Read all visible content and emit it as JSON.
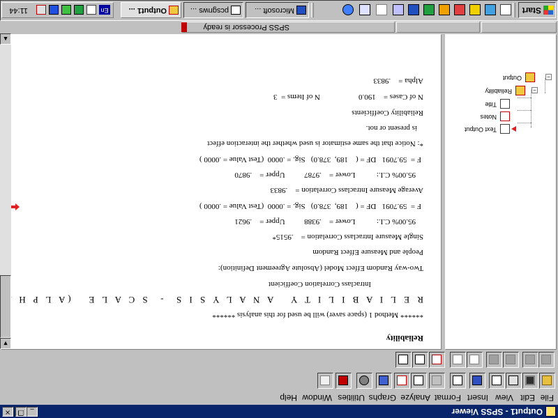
{
  "window": {
    "title": "Output1 - SPSS Viewer",
    "min_label": "_",
    "max_label": "❐",
    "close_label": "×"
  },
  "menu": [
    "File",
    "Edit",
    "View",
    "Insert",
    "Format",
    "Analyze",
    "Graphs",
    "Utilities",
    "Window",
    "Help"
  ],
  "outline": {
    "items": [
      {
        "label": "Output",
        "icon": "output-book-icon"
      },
      {
        "label": "Reliability",
        "icon": "procedure-book-icon"
      },
      {
        "label": "Title",
        "icon": "title-page-icon"
      },
      {
        "label": "Notes",
        "icon": "notes-page-icon"
      },
      {
        "label": "Text Output",
        "icon": "text-output-page-icon",
        "selected_arrow": true
      }
    ]
  },
  "output": {
    "heading": "Reliability",
    "method_note": "****** Method 1 (space saver) will be used for this analysis ******",
    "analysis_title": "R E L I A B I L I T Y   A N A L Y S I S  -  S C A L E   (A L P H A)",
    "icc_title": "Intraclass Correlation Coefficient",
    "model": "Two-way Random Effect Model (Absolute Agreement Definition):",
    "effects": "People and Measure Effect Random",
    "single_measure": "Single Measure Intraclass Correlation =    .9515*",
    "single_ci": "95.00% C.I.:           Lower =    .9388          Upper =    .9621",
    "single_f": "F =  59.7091   DF = (    189,  378.0)   Sig. = .0000  (Test Value = .0000 )",
    "average_measure": "Average Measure Intraclass Correlation =    .9833",
    "average_ci": "95.00% C.I.:           Lower =    .9787          Upper =    .9870",
    "average_f": "F =  59.7091   DF = (    189,  378.0)   Sig. = .0000  (Test Value = .0000 )",
    "notice_1": "*: Notice that the same estimator is used whether the interaction effect",
    "notice_2": "is present or not.",
    "coef_title": "Reliability Coefficients",
    "cases": "N of Cases =    190.0                    N of Items =  3",
    "alpha": "Alpha =    .9833"
  },
  "status": {
    "processor": "SPSS Processor  is ready"
  },
  "taskbar": {
    "start_label": "Start",
    "tasks": [
      {
        "label": "Microsoft ...",
        "icon": "word-icon"
      },
      {
        "label": "pcsgnws ...",
        "icon": "window-icon"
      },
      {
        "label": "Output1 ...",
        "icon": "spss-icon"
      }
    ],
    "clock": "11:44",
    "language": "En"
  },
  "colors": {
    "title_bar": "#08246b",
    "face": "#c0c0c0",
    "arrow_red": "#e02020"
  }
}
